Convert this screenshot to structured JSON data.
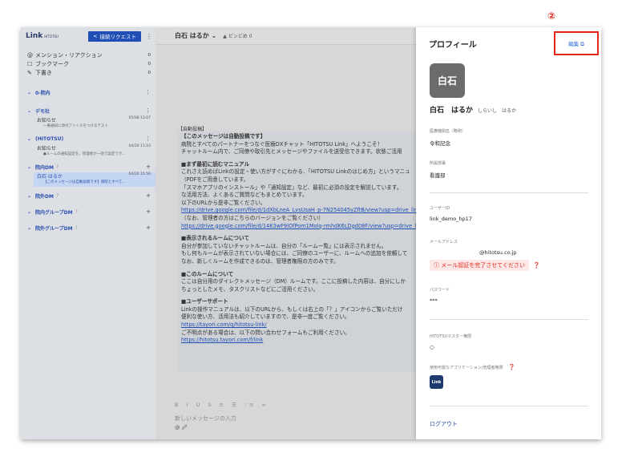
{
  "annotation": {
    "number": "②"
  },
  "sidebar": {
    "logo": "Link",
    "logo_sub": "HITOTSU",
    "request_button": "接続リクエスト",
    "menu": [
      {
        "icon": "@",
        "label": "メンション・リアクション",
        "count": "0"
      },
      {
        "icon": "☐",
        "label": "ブックマーク",
        "count": "0"
      },
      {
        "icon": "✎",
        "label": "下書き",
        "count": "0"
      }
    ],
    "sections": [
      {
        "label": "0-院内"
      },
      {
        "label": "デモ社"
      },
      {
        "label": "(HITOTSU)"
      },
      {
        "label": "院内DM"
      },
      {
        "label": "院外DM"
      },
      {
        "label": "院内グループDM"
      },
      {
        "label": "院外グループDM"
      }
    ],
    "channels": [
      {
        "name": "お知らせ",
        "date": "05/08 13:07",
        "preview": "一番通知に添付ファイルをつけるテスト"
      },
      {
        "name": "お知らせ",
        "date": "04/26 11:10",
        "preview": "●ルームの通知設定を、管理者が一括で設定でき..."
      },
      {
        "name": "白石 はるか",
        "date": "04/26 15:56",
        "preview": "【このメッセージは自動投稿です】病院とすべて..."
      }
    ]
  },
  "chat": {
    "title": "白石 はるか ⌄",
    "pin": "ピンどめ 0",
    "auto_label": "【自動投稿】",
    "lines": [
      {
        "t": "【このメッセージは自動投稿です】",
        "k": "b"
      },
      {
        "t": "病院とすべてのパートナーをつなぐ医療DXチャット「HITOTSU Link」へようこそ！",
        "k": ""
      },
      {
        "t": "チャットルーム内で、ご同僚や取引先とメッセージやファイルを送受信できます。状態ご活用",
        "k": ""
      },
      {
        "t": "",
        "k": "gap"
      },
      {
        "t": "■まず最初に読むマニュアル",
        "k": "b"
      },
      {
        "t": "これさえ読めばLinkの設定・使い方がすぐにわかる、「HITOTSU Linkのはじめ方」というマニュ",
        "k": ""
      },
      {
        "t": "（PDFをご用意しています。",
        "k": ""
      },
      {
        "t": "「スマホアプリのインストール」や「通知設定」など、最初に必須の設定を解説しています。",
        "k": ""
      },
      {
        "t": "な活用方法、よくあるご質問などもまとめています。",
        "k": ""
      },
      {
        "t": "以下のURLから是非ご覧ください。",
        "k": ""
      },
      {
        "t": "https://drive.google.com/file/d/1dXbLneA_LvsUsaH_p-7N254045yZftB/view?usp=drive_link",
        "k": "a"
      },
      {
        "t": "（なお、管理者の方はこちらのバージョンをご覧ください）",
        "k": ""
      },
      {
        "t": "https://drive.google.com/file/d/14K3wF9lOfPom1Molq-rmhdK6LDgd08F/view?usp=drive_link",
        "k": "a"
      },
      {
        "t": "",
        "k": "gap"
      },
      {
        "t": "■表示されるルームについて",
        "k": "b"
      },
      {
        "t": "自分が参加していないチャットルームは、自分の「ルーム一覧」には表示されません。",
        "k": ""
      },
      {
        "t": "もし何もルームが表示されていない場合には、ご同僚のユーザーに、ルームへの追加を依頼して",
        "k": ""
      },
      {
        "t": "なお、新しくルームを作成できるのは、管理者権限の方のみです。",
        "k": ""
      },
      {
        "t": "",
        "k": "gap"
      },
      {
        "t": "■このルームについて",
        "k": "b"
      },
      {
        "t": "ここは自分用のダイレクトメッセージ（DM）ルームです。ここに投稿した内容は、自分にしか",
        "k": ""
      },
      {
        "t": "ちょっとしたメモ、タスクリストなどにご活用ください。",
        "k": ""
      },
      {
        "t": "",
        "k": "gap"
      },
      {
        "t": "■ユーザーサポート",
        "k": "b"
      },
      {
        "t": "Linkの操作マニュアルは、以下のURLから、もしくは右上の「？」アイコンからご覧いただけ",
        "k": ""
      },
      {
        "t": "便利な使い方、活用法も紹介していますので、是非一度ご覧ください。",
        "k": ""
      },
      {
        "t": "https://tayori.com/q/hitotsu-link/",
        "k": "a"
      },
      {
        "t": "ご不明点がある場合は、以下の問い合わせフォームもご利用ください。",
        "k": ""
      },
      {
        "t": "https://hitotsu.tayori.com/f/link",
        "k": "a"
      }
    ],
    "toolbar": "B I U S ≡ ☰ ⁝≡ ∞",
    "placeholder": "新しいメッセージの入力",
    "attach": "@ 🖉"
  },
  "profile": {
    "title": "プロフィール",
    "edit": "編集 ⧉",
    "avatar_text": "白石",
    "name": "白石　はるか",
    "kana": "しらいし　はるか",
    "fields": [
      {
        "label": "医療機関名（略称）",
        "value": "令和記念"
      },
      {
        "label": "所属部署",
        "value": "看護部"
      },
      {
        "label": "ユーザーID",
        "value": "link_demo_hp17"
      },
      {
        "label": "メールアドレス",
        "value": "@hitotsu.co.jp"
      },
      {
        "label": "パスワード",
        "value": "***"
      },
      {
        "label": "HITOTSUマスター権限",
        "value": "○"
      },
      {
        "label": "使用可能なアプリケーション/管理者権限",
        "value": ""
      }
    ],
    "email_warning": "ⓘ メール認証を完了させてください",
    "app_icon": "Link",
    "logout": "ログアウト"
  }
}
